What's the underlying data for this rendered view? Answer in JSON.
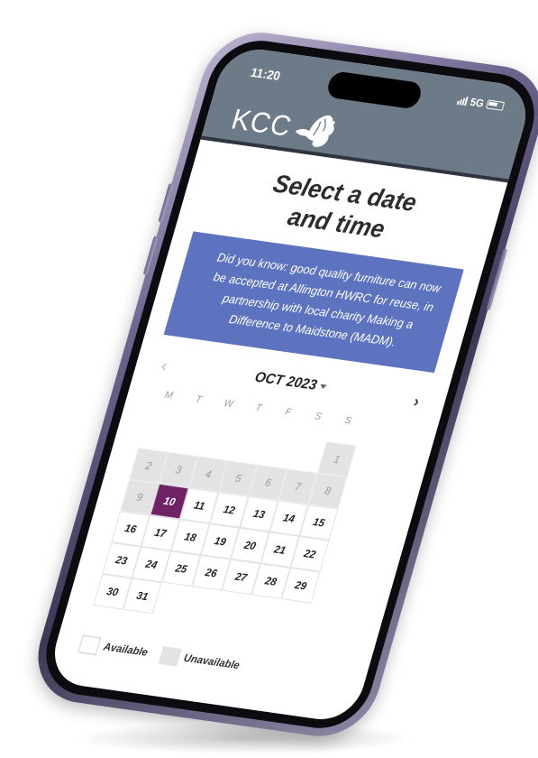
{
  "status": {
    "time": "11:20",
    "network": "5G"
  },
  "brand": {
    "logo_text": "KCC"
  },
  "page": {
    "title_line1": "Select a date",
    "title_line2": "and time"
  },
  "info": {
    "text": "Did you know: good quality furniture can now be accepted at Allington HWRC for reuse, in partnership with local charity Making a Difference to Maidstone (MADM)."
  },
  "calendar": {
    "month_label": "OCT 2023",
    "weekdays": [
      "M",
      "T",
      "W",
      "T",
      "F",
      "S",
      "S"
    ],
    "rows": [
      [
        {
          "d": "",
          "s": "empty"
        },
        {
          "d": "",
          "s": "empty"
        },
        {
          "d": "",
          "s": "empty"
        },
        {
          "d": "",
          "s": "empty"
        },
        {
          "d": "",
          "s": "empty"
        },
        {
          "d": "",
          "s": "empty"
        },
        {
          "d": "1",
          "s": "unavailable"
        }
      ],
      [
        {
          "d": "2",
          "s": "unavailable"
        },
        {
          "d": "3",
          "s": "unavailable"
        },
        {
          "d": "4",
          "s": "unavailable"
        },
        {
          "d": "5",
          "s": "unavailable"
        },
        {
          "d": "6",
          "s": "unavailable"
        },
        {
          "d": "7",
          "s": "unavailable"
        },
        {
          "d": "8",
          "s": "unavailable"
        }
      ],
      [
        {
          "d": "9",
          "s": "unavailable"
        },
        {
          "d": "10",
          "s": "selected"
        },
        {
          "d": "11",
          "s": "available"
        },
        {
          "d": "12",
          "s": "available"
        },
        {
          "d": "13",
          "s": "available"
        },
        {
          "d": "14",
          "s": "available"
        },
        {
          "d": "15",
          "s": "available"
        }
      ],
      [
        {
          "d": "16",
          "s": "available"
        },
        {
          "d": "17",
          "s": "available"
        },
        {
          "d": "18",
          "s": "available"
        },
        {
          "d": "19",
          "s": "available"
        },
        {
          "d": "20",
          "s": "available"
        },
        {
          "d": "21",
          "s": "available"
        },
        {
          "d": "22",
          "s": "available"
        }
      ],
      [
        {
          "d": "23",
          "s": "available"
        },
        {
          "d": "24",
          "s": "available"
        },
        {
          "d": "25",
          "s": "available"
        },
        {
          "d": "26",
          "s": "available"
        },
        {
          "d": "27",
          "s": "available"
        },
        {
          "d": "28",
          "s": "available"
        },
        {
          "d": "29",
          "s": "available"
        }
      ],
      [
        {
          "d": "30",
          "s": "available"
        },
        {
          "d": "31",
          "s": "available"
        }
      ]
    ]
  },
  "legend": {
    "available_label": "Available",
    "unavailable_label": "Unavailable"
  },
  "colors": {
    "header": "#6d7a88",
    "info_bg": "#5e73c0",
    "selected": "#6e2366",
    "unavailable": "#e3e3e3"
  }
}
